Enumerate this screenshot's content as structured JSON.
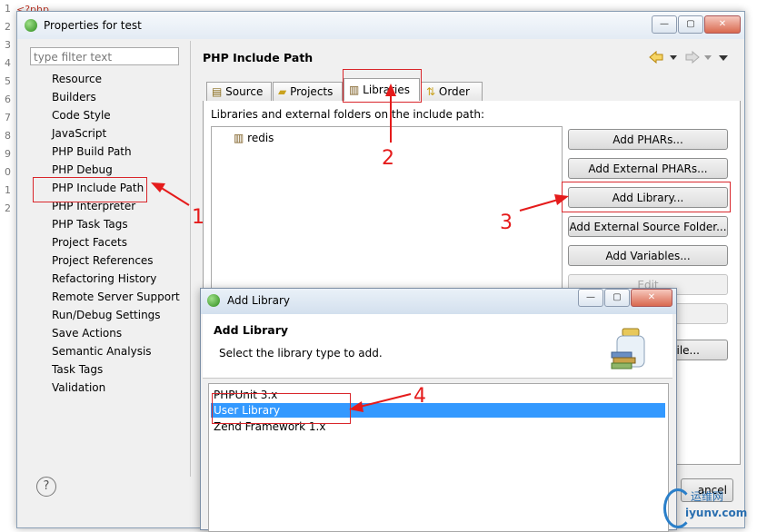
{
  "background": {
    "code_fragment": "<?php",
    "gutter": [
      "1",
      "2",
      "3",
      "4",
      "5",
      "6",
      "7",
      "8",
      "9",
      "0",
      "1",
      "2"
    ]
  },
  "window": {
    "title": "Properties for test",
    "controls": {
      "minimize": "—",
      "maximize": "▢",
      "close": "✕"
    },
    "filter_placeholder": "type filter text",
    "nav_items": [
      "Resource",
      "Builders",
      "Code Style",
      "JavaScript",
      "PHP Build Path",
      "PHP Debug",
      "PHP Include Path",
      "PHP Interpreter",
      "PHP Task Tags",
      "Project Facets",
      "Project References",
      "Refactoring History",
      "Remote Server Support",
      "Run/Debug Settings",
      "Save Actions",
      "Semantic Analysis",
      "Task Tags",
      "Validation"
    ],
    "selected_nav": "PHP Include Path",
    "page_title": "PHP Include Path",
    "tabs": [
      {
        "label": "Source"
      },
      {
        "label": "Projects"
      },
      {
        "label": "Libraries",
        "active": true
      },
      {
        "label": "Order"
      }
    ],
    "panel_caption": "Libraries and external folders on the include path:",
    "libraries": [
      "redis"
    ],
    "buttons": [
      {
        "label": "Add PHARs...",
        "enabled": true
      },
      {
        "label": "Add External PHARs...",
        "enabled": true
      },
      {
        "label": "Add Library...",
        "enabled": true
      },
      {
        "label": "Add External Source Folder...",
        "enabled": true
      },
      {
        "label": "Add Variables...",
        "enabled": true
      },
      {
        "label": "Edit",
        "enabled": false
      }
    ],
    "partial_button": "File...",
    "cancel_label": "ancel",
    "help_symbol": "?"
  },
  "dialog": {
    "title": "Add Library",
    "heading": "Add Library",
    "description": "Select the library type to add.",
    "options": [
      "PHPUnit 3.x",
      "User Library",
      "Zend Framework 1.x"
    ],
    "selected": "User Library"
  },
  "annotations": [
    "1",
    "2",
    "3",
    "4"
  ],
  "watermark": {
    "line1": "运维网",
    "line2": "iyunv.com"
  },
  "colors": {
    "annotation": "#e51b1b",
    "selection": "#3399ff"
  }
}
